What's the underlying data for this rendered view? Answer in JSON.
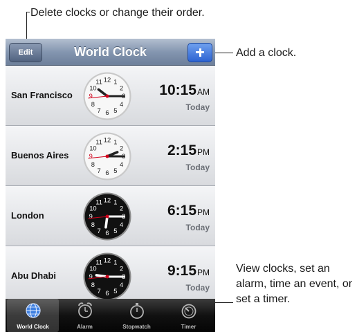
{
  "callouts": {
    "top": "Delete clocks or change their order.",
    "add": "Add a clock.",
    "bottom": "View clocks, set an alarm, time an event, or set a timer."
  },
  "navbar": {
    "title": "World Clock",
    "edit_label": "Edit",
    "add_icon": "plus-icon"
  },
  "clocks": [
    {
      "city": "San Francisco",
      "time": "10:15",
      "ampm": "AM",
      "day": "Today",
      "hour": 10,
      "minute": 15,
      "second": 44,
      "face": "light"
    },
    {
      "city": "Buenos Aires",
      "time": "2:15",
      "ampm": "PM",
      "day": "Today",
      "hour": 2,
      "minute": 15,
      "second": 44,
      "face": "light"
    },
    {
      "city": "London",
      "time": "6:15",
      "ampm": "PM",
      "day": "Today",
      "hour": 6,
      "minute": 15,
      "second": 44,
      "face": "dark"
    },
    {
      "city": "Abu Dhabi",
      "time": "9:15",
      "ampm": "PM",
      "day": "Today",
      "hour": 9,
      "minute": 15,
      "second": 44,
      "face": "dark"
    }
  ],
  "tabs": [
    {
      "label": "World Clock",
      "icon": "globe-icon",
      "active": true
    },
    {
      "label": "Alarm",
      "icon": "alarm-clock-icon",
      "active": false
    },
    {
      "label": "Stopwatch",
      "icon": "stopwatch-icon",
      "active": false
    },
    {
      "label": "Timer",
      "icon": "timer-icon",
      "active": false
    }
  ],
  "colors": {
    "accent_blue": "#2c63d2",
    "second_hand": "#d0021b"
  }
}
